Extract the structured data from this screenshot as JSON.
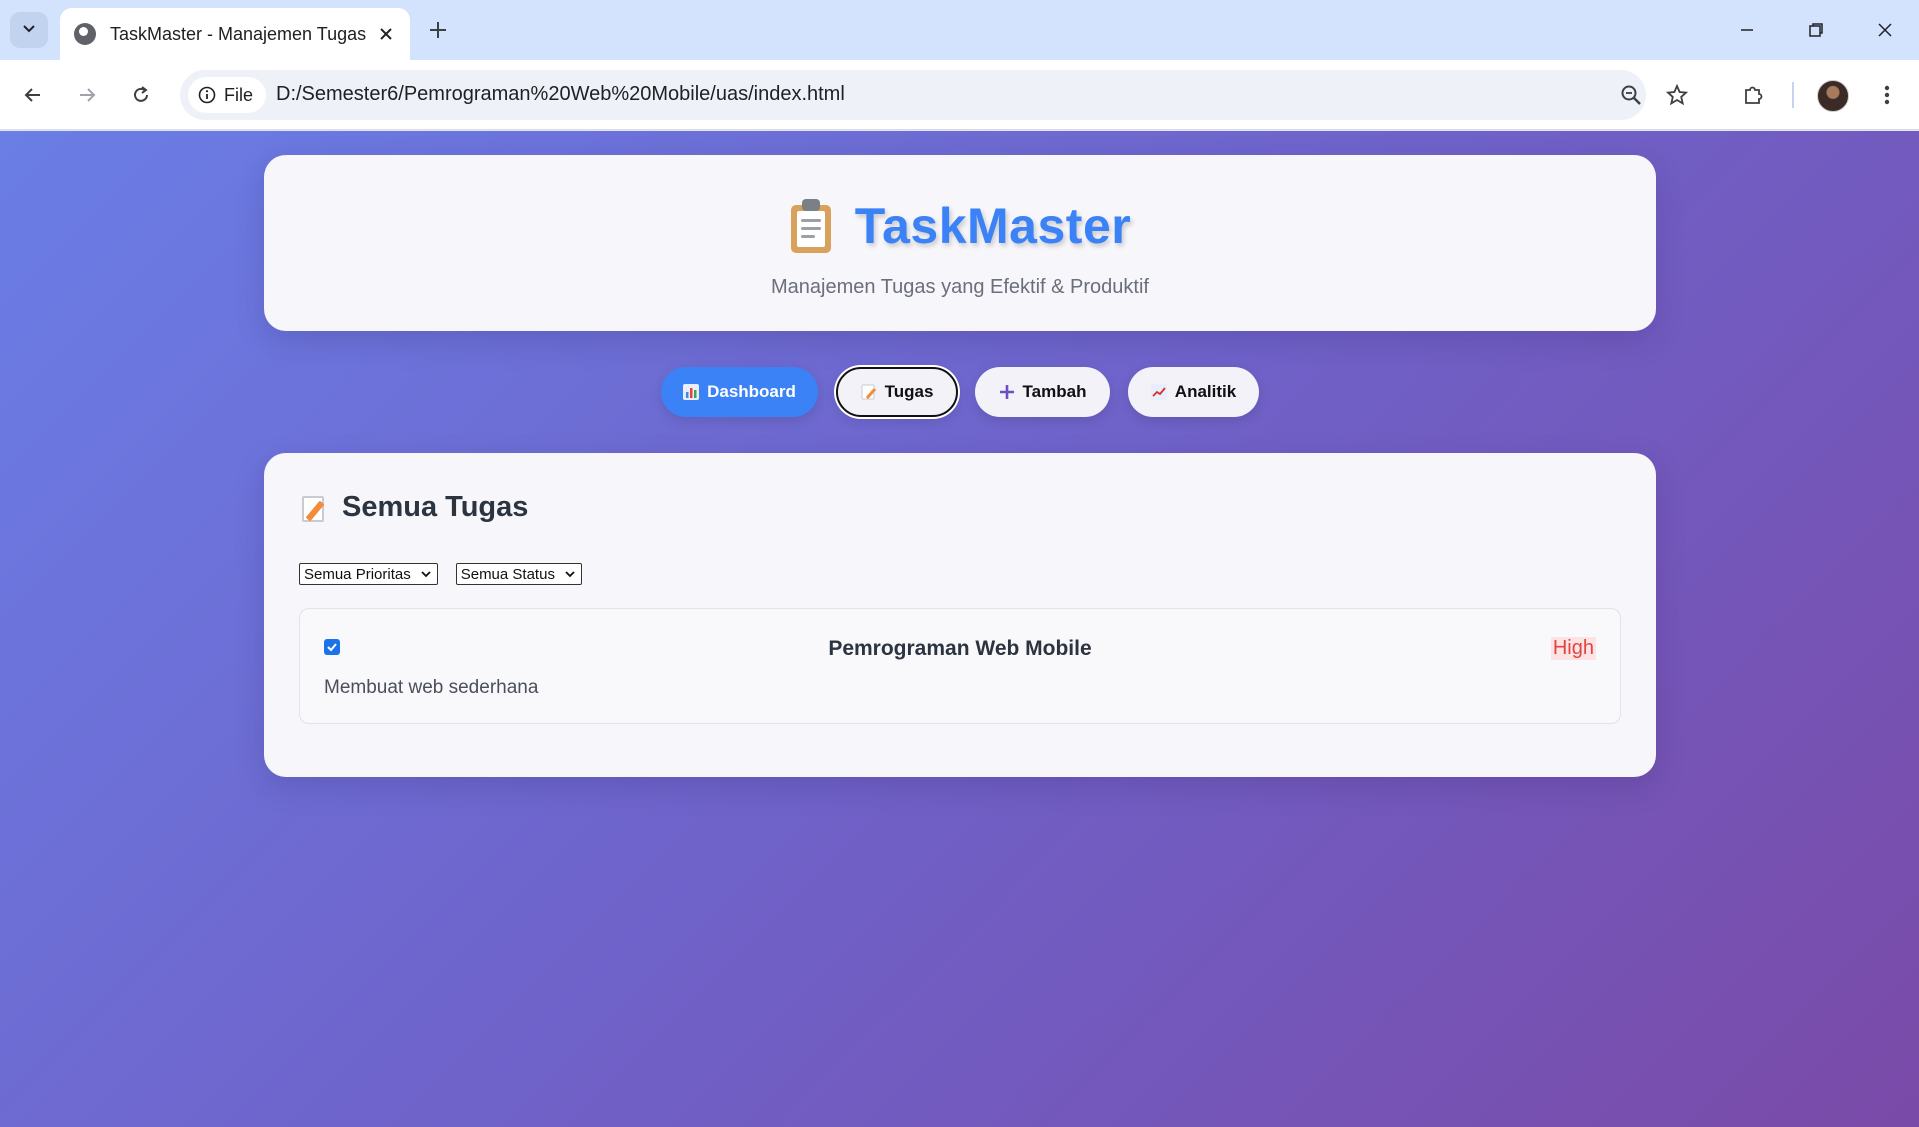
{
  "browser": {
    "tab_title": "TaskMaster - Manajemen Tugas",
    "site_chip_label": "File",
    "url": "D:/Semester6/Pemrograman%20Web%20Mobile/uas/index.html"
  },
  "header": {
    "brand_icon": "clipboard-icon",
    "title": "TaskMaster",
    "subtitle": "Manajemen Tugas yang Efektif & Produktif"
  },
  "nav": {
    "items": [
      {
        "icon": "bar-chart-icon",
        "label": "Dashboard",
        "state": "active"
      },
      {
        "icon": "memo-icon",
        "label": "Tugas",
        "state": "focused"
      },
      {
        "icon": "plus-icon",
        "label": "Tambah",
        "state": "normal"
      },
      {
        "icon": "trend-chart-icon",
        "label": "Analitik",
        "state": "normal"
      }
    ]
  },
  "tasks_section": {
    "icon": "memo-icon",
    "title": "Semua Tugas",
    "filters": {
      "priority_selected": "Semua Prioritas",
      "status_selected": "Semua Status"
    },
    "tasks": [
      {
        "title": "Pemrograman Web Mobile",
        "description": "Membuat web sederhana",
        "priority": "High",
        "completed": true
      }
    ]
  },
  "colors": {
    "accent": "#3b82f6",
    "priority_high": "#e04545",
    "bg_gradient_start": "#6a7ee6",
    "bg_gradient_end": "#7a4aa8"
  }
}
